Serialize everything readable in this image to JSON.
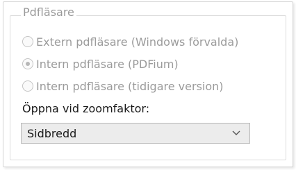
{
  "pdf_settings": {
    "group_title": "Pdfläsare",
    "options": [
      {
        "label": "Extern pdfläsare (Windows förvalda)",
        "selected": false,
        "enabled": false
      },
      {
        "label": "Intern pdfläsare (PDFium)",
        "selected": true,
        "enabled": false
      },
      {
        "label": "Intern pdfläsare (tidigare version)",
        "selected": false,
        "enabled": false
      }
    ],
    "zoom_label": "Öppna vid zoomfaktor:",
    "zoom_select": {
      "value": "Sidbredd",
      "icon": "chevron-down-icon"
    }
  },
  "colors": {
    "disabled_text": "#9b9b9b",
    "text": "#1a1a1a",
    "dropdown_bg": "#ececec"
  }
}
